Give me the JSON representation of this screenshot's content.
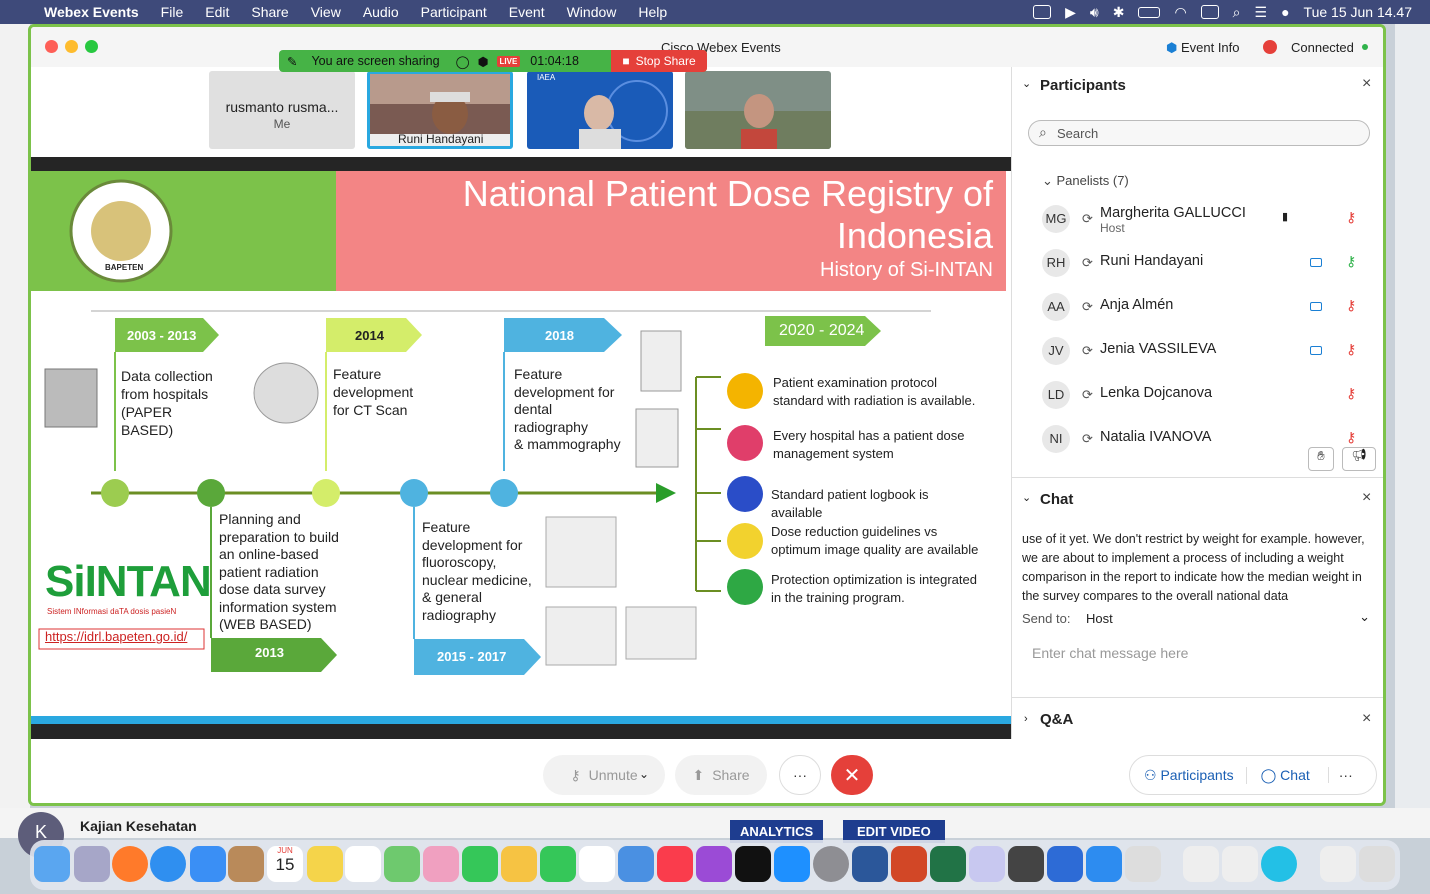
{
  "menubar": {
    "app": "Webex Events",
    "items": [
      "File",
      "Edit",
      "Share",
      "View",
      "Audio",
      "Participant",
      "Event",
      "Window",
      "Help"
    ],
    "datetime": "Tue 15 Jun  14.47"
  },
  "background": {
    "channel": "Kajian Kesehatan",
    "avatar": "K",
    "btn1": "ANALYTICS",
    "btn2": "EDIT VIDEO"
  },
  "window": {
    "title": "Cisco Webex Events",
    "event_info": "Event Info",
    "status": "Connected"
  },
  "sharebar": {
    "text": "You are screen sharing",
    "live": "LIVE",
    "timer": "01:04:18",
    "stop": "Stop Share"
  },
  "thumbs": {
    "me_name": "rusmanto rusma...",
    "me_label": "Me",
    "speaker": "Runi Handayani",
    "iaea": "IAEA"
  },
  "slide": {
    "title1": "National Patient Dose Registry of",
    "title2": "Indonesia",
    "subtitle": "History of Si-INTAN",
    "logo_text": "BAPETEN",
    "m1_year": "2003 - 2013",
    "m1_text": [
      "Data collection",
      "from hospitals",
      "(PAPER",
      "BASED)"
    ],
    "m2_year": "2014",
    "m2_text": [
      "Feature",
      "development",
      "for CT Scan"
    ],
    "m3_year": "2018",
    "m3_text": [
      "Feature",
      "development for",
      "dental",
      "radiography",
      "& mammography"
    ],
    "m4_year": "2020 - 2024",
    "m5_year": "2013",
    "m5_text": [
      "Planning and",
      "preparation to build",
      "an online-based",
      "patient radiation",
      "dose data survey",
      "information system",
      "(WEB BASED)"
    ],
    "m6_year": "2015 - 2017",
    "m6_text": [
      "Feature",
      "development for",
      "fluoroscopy,",
      "nuclear medicine,",
      "& general",
      "radiography"
    ],
    "sintan": "SiINTAN",
    "sintan_sub": "Sistem INformasi daTA dosis pasieN",
    "url": "https://idrl.bapeten.go.id/",
    "plans": [
      [
        "Patient examination protocol",
        "standard with radiation is available."
      ],
      [
        "Every hospital has a patient dose",
        "management system"
      ],
      [
        "Standard patient logbook is",
        "available"
      ],
      [
        "Dose reduction guidelines vs",
        "optimum image quality are available"
      ],
      [
        "Protection optimization is integrated",
        "in the training program."
      ]
    ]
  },
  "participants": {
    "title": "Participants",
    "search": "Search",
    "group": "Panelists (7)",
    "list": [
      {
        "ini": "MG",
        "name": "Margherita GALLUCCI",
        "role": "Host"
      },
      {
        "ini": "RH",
        "name": "Runi Handayani"
      },
      {
        "ini": "AA",
        "name": "Anja Almén"
      },
      {
        "ini": "JV",
        "name": "Jenia VASSILEVA"
      },
      {
        "ini": "LD",
        "name": "Lenka Dojcanova"
      },
      {
        "ini": "NI",
        "name": "Natalia IVANOVA"
      }
    ]
  },
  "chat": {
    "title": "Chat",
    "message": "use of it yet. We don't restrict by weight for example. however, we are about to implement a process of including a weight comparison in the report to indicate how the median weight in the survey compares to the overall national data",
    "send_to_label": "Send to:",
    "send_to": "Host",
    "placeholder": "Enter chat message here"
  },
  "qa": {
    "title": "Q&A"
  },
  "controls": {
    "unmute": "Unmute",
    "share": "Share",
    "more": "···",
    "participants": "Participants",
    "chat": "Chat"
  },
  "dock": {
    "calendar_month": "JUN",
    "calendar_day": "15"
  },
  "colors": {
    "accent_green": "#7cc24a",
    "share_green": "#46b346",
    "danger": "#e5403a",
    "link_blue": "#1a7fd4"
  }
}
